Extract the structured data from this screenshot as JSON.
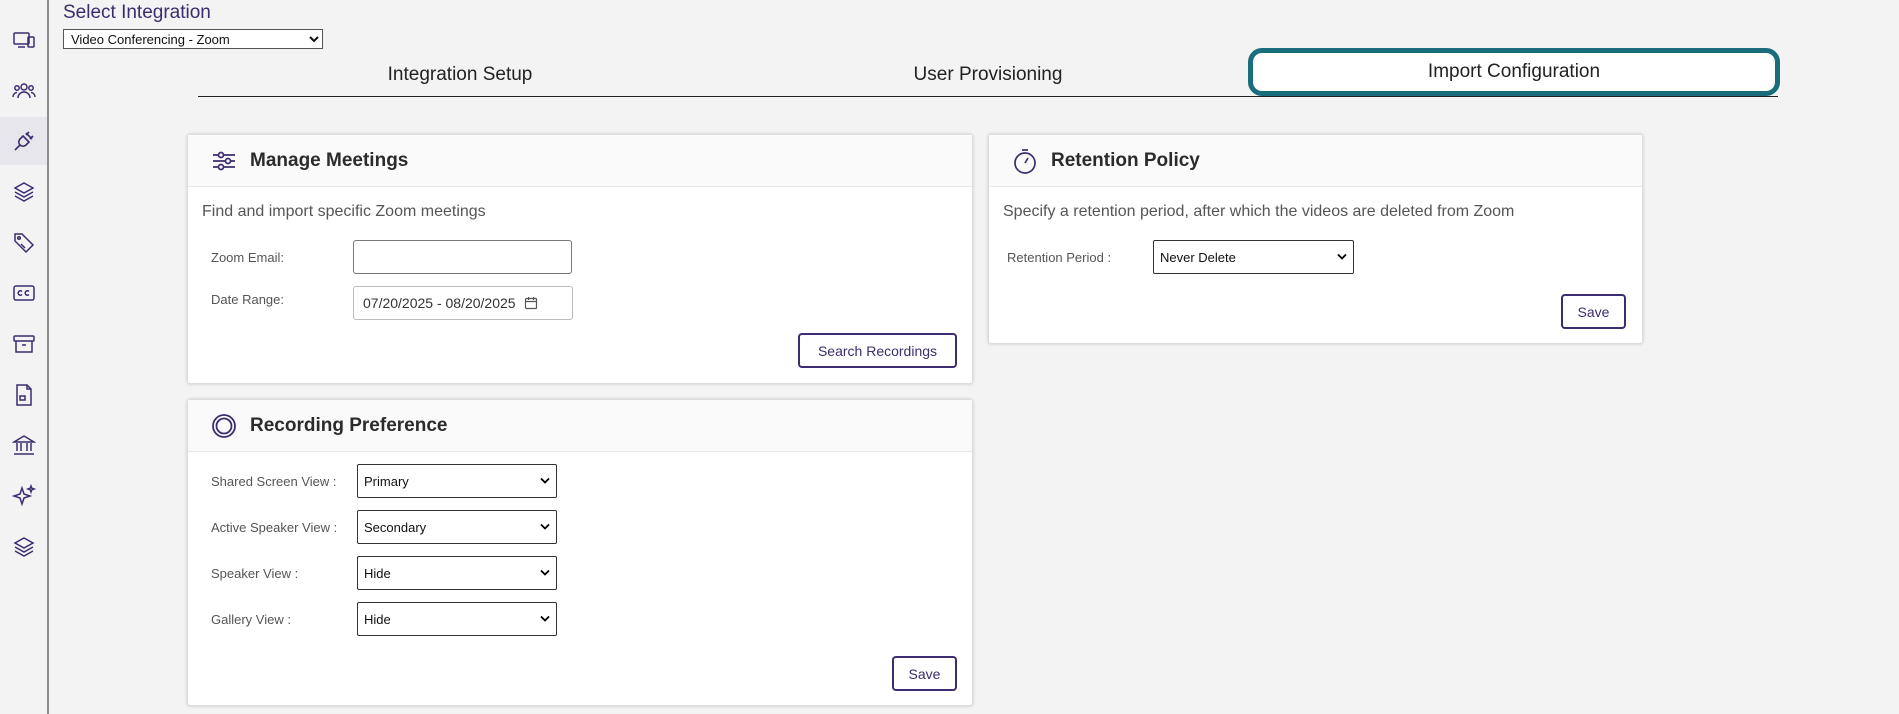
{
  "sidebar": {
    "items": [
      {
        "icon": "devices-icon"
      },
      {
        "icon": "users-icon"
      },
      {
        "icon": "integration-plug-icon",
        "active": true
      },
      {
        "icon": "layers-icon"
      },
      {
        "icon": "tag-icon"
      },
      {
        "icon": "captions-icon"
      },
      {
        "icon": "archive-icon"
      },
      {
        "icon": "document-icon"
      },
      {
        "icon": "institution-icon"
      },
      {
        "icon": "sparkle-icon"
      },
      {
        "icon": "stack-icon"
      }
    ]
  },
  "header": {
    "select_label": "Select Integration",
    "integration_value": "Video Conferencing - Zoom"
  },
  "tabs": [
    {
      "label": "Integration Setup"
    },
    {
      "label": "User Provisioning"
    },
    {
      "label": "Import Configuration",
      "active": true
    }
  ],
  "manage_meetings": {
    "title": "Manage Meetings",
    "description": "Find and import specific Zoom meetings",
    "email_label": "Zoom Email:",
    "email_value": "",
    "date_label": "Date Range:",
    "date_value": "07/20/2025 - 08/20/2025",
    "search_button": "Search Recordings"
  },
  "recording_preference": {
    "title": "Recording Preference",
    "fields": [
      {
        "label": "Shared Screen View :",
        "value": "Primary"
      },
      {
        "label": "Active Speaker View :",
        "value": "Secondary"
      },
      {
        "label": "Speaker View :",
        "value": "Hide"
      },
      {
        "label": "Gallery View :",
        "value": "Hide"
      }
    ],
    "save_button": "Save"
  },
  "retention_policy": {
    "title": "Retention Policy",
    "description": "Specify a retention period, after which the videos are deleted from Zoom",
    "period_label": "Retention Period :",
    "period_value": "Never Delete",
    "save_button": "Save"
  },
  "colors": {
    "accent": "#3d2c6f",
    "active_tab_border": "#1a6e7c"
  }
}
